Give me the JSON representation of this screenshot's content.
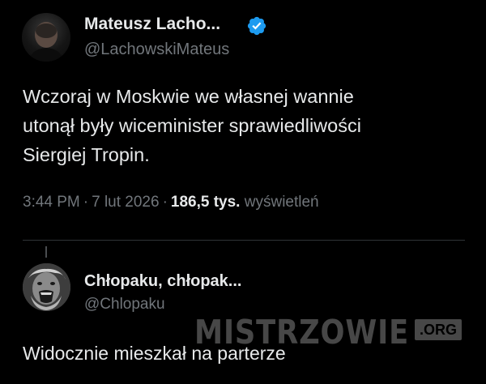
{
  "main_tweet": {
    "author": {
      "display_name": "Mateusz Lacho...",
      "handle": "@LachowskiMateus",
      "verified": true,
      "verified_color": "#1d9bf0"
    },
    "text_lines": [
      "Wczoraj w Moskwie we własnej wannie",
      "utonął były wiceminister sprawiedliwości",
      "Siergiej Tropin."
    ],
    "time": "3:44 PM",
    "date": "7 lut 2026",
    "views_count": "186,5 tys.",
    "views_label": "wyświetleń",
    "separator": "·"
  },
  "reply_tweet": {
    "author": {
      "display_name": "Chłopaku, chłopak...",
      "handle": "@Chlopaku"
    },
    "text": "Widocznie mieszkał na parterze"
  },
  "watermark": {
    "text": "MISTRZOWIE",
    "tld": ".ORG"
  },
  "colors": {
    "background": "#000000",
    "primary_text": "#e7e9ea",
    "secondary_text": "#71767b",
    "divider": "#2f3336",
    "accent": "#1d9bf0"
  }
}
